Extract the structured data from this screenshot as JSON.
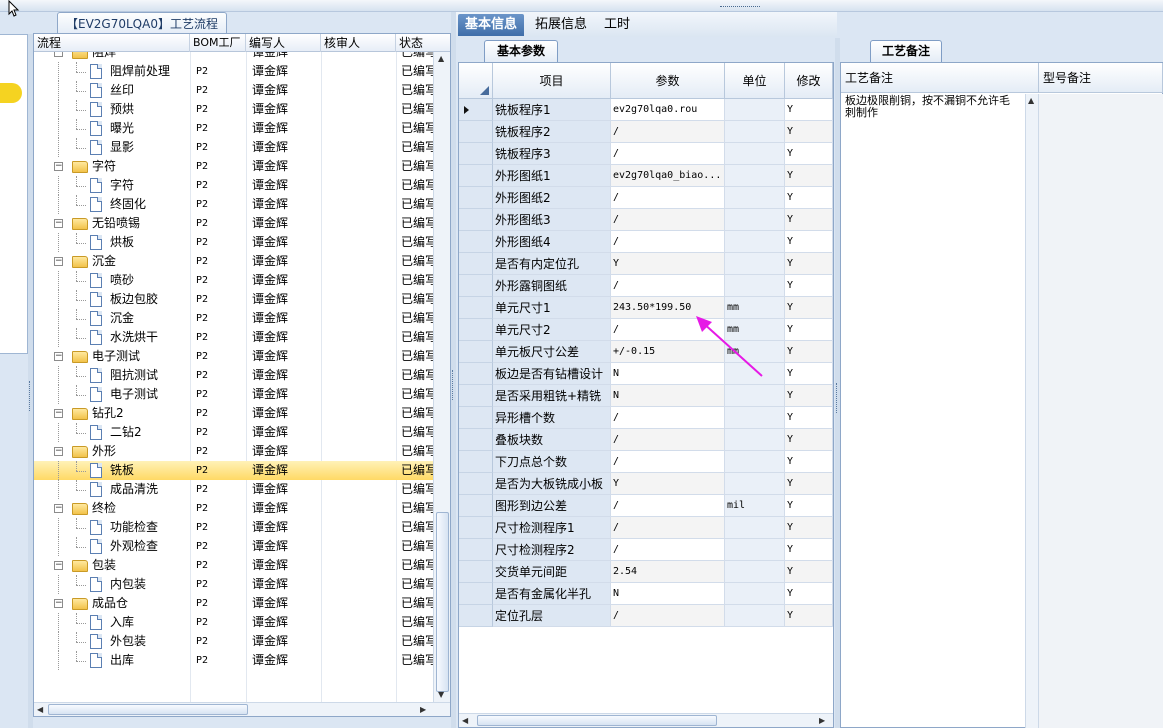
{
  "tree": {
    "tab_title": "【EV2G70LQA0】工艺流程",
    "columns": [
      "流程",
      "BOM工厂",
      "编写人",
      "核审人",
      "状态"
    ],
    "rows": [
      {
        "level": 0,
        "type": "folder",
        "name": "阻焊",
        "bom": "",
        "author": "谭金辉",
        "reviewer": "",
        "status": "已编写"
      },
      {
        "level": 1,
        "type": "doc",
        "name": "阻焊前处理",
        "bom": "P2",
        "author": "谭金辉",
        "reviewer": "",
        "status": "已编写"
      },
      {
        "level": 1,
        "type": "doc",
        "name": "丝印",
        "bom": "P2",
        "author": "谭金辉",
        "reviewer": "",
        "status": "已编写"
      },
      {
        "level": 1,
        "type": "doc",
        "name": "预烘",
        "bom": "P2",
        "author": "谭金辉",
        "reviewer": "",
        "status": "已编写"
      },
      {
        "level": 1,
        "type": "doc",
        "name": "曝光",
        "bom": "P2",
        "author": "谭金辉",
        "reviewer": "",
        "status": "已编写"
      },
      {
        "level": 1,
        "type": "doc",
        "name": "显影",
        "bom": "P2",
        "author": "谭金辉",
        "reviewer": "",
        "status": "已编写"
      },
      {
        "level": 0,
        "type": "folder",
        "name": "字符",
        "bom": "P2",
        "author": "谭金辉",
        "reviewer": "",
        "status": "已编写"
      },
      {
        "level": 1,
        "type": "doc",
        "name": "字符",
        "bom": "P2",
        "author": "谭金辉",
        "reviewer": "",
        "status": "已编写"
      },
      {
        "level": 1,
        "type": "doc",
        "name": "终固化",
        "bom": "P2",
        "author": "谭金辉",
        "reviewer": "",
        "status": "已编写"
      },
      {
        "level": 0,
        "type": "folder",
        "name": "无铅喷锡",
        "bom": "P2",
        "author": "谭金辉",
        "reviewer": "",
        "status": "已编写"
      },
      {
        "level": 1,
        "type": "doc",
        "name": "烘板",
        "bom": "P2",
        "author": "谭金辉",
        "reviewer": "",
        "status": "已编写"
      },
      {
        "level": 0,
        "type": "folder",
        "name": "沉金",
        "bom": "P2",
        "author": "谭金辉",
        "reviewer": "",
        "status": "已编写"
      },
      {
        "level": 1,
        "type": "doc",
        "name": "喷砂",
        "bom": "P2",
        "author": "谭金辉",
        "reviewer": "",
        "status": "已编写"
      },
      {
        "level": 1,
        "type": "doc",
        "name": "板边包胶",
        "bom": "P2",
        "author": "谭金辉",
        "reviewer": "",
        "status": "已编写"
      },
      {
        "level": 1,
        "type": "doc",
        "name": "沉金",
        "bom": "P2",
        "author": "谭金辉",
        "reviewer": "",
        "status": "已编写"
      },
      {
        "level": 1,
        "type": "doc",
        "name": "水洗烘干",
        "bom": "P2",
        "author": "谭金辉",
        "reviewer": "",
        "status": "已编写"
      },
      {
        "level": 0,
        "type": "folder",
        "name": "电子测试",
        "bom": "P2",
        "author": "谭金辉",
        "reviewer": "",
        "status": "已编写"
      },
      {
        "level": 1,
        "type": "doc",
        "name": "阻抗测试",
        "bom": "P2",
        "author": "谭金辉",
        "reviewer": "",
        "status": "已编写"
      },
      {
        "level": 1,
        "type": "doc",
        "name": "电子测试",
        "bom": "P2",
        "author": "谭金辉",
        "reviewer": "",
        "status": "已编写"
      },
      {
        "level": 0,
        "type": "folder",
        "name": "钻孔2",
        "bom": "P2",
        "author": "谭金辉",
        "reviewer": "",
        "status": "已编写"
      },
      {
        "level": 1,
        "type": "doc",
        "name": "二钻2",
        "bom": "P2",
        "author": "谭金辉",
        "reviewer": "",
        "status": "已编写"
      },
      {
        "level": 0,
        "type": "folder",
        "name": "外形",
        "bom": "P2",
        "author": "谭金辉",
        "reviewer": "",
        "status": "已编写"
      },
      {
        "level": 1,
        "type": "doc",
        "name": "铣板",
        "bom": "P2",
        "author": "谭金辉",
        "reviewer": "",
        "status": "已编写",
        "selected": true
      },
      {
        "level": 1,
        "type": "doc",
        "name": "成品清洗",
        "bom": "P2",
        "author": "谭金辉",
        "reviewer": "",
        "status": "已编写"
      },
      {
        "level": 0,
        "type": "folder",
        "name": "终检",
        "bom": "P2",
        "author": "谭金辉",
        "reviewer": "",
        "status": "已编写"
      },
      {
        "level": 1,
        "type": "doc",
        "name": "功能检查",
        "bom": "P2",
        "author": "谭金辉",
        "reviewer": "",
        "status": "已编写"
      },
      {
        "level": 1,
        "type": "doc",
        "name": "外观检查",
        "bom": "P2",
        "author": "谭金辉",
        "reviewer": "",
        "status": "已编写"
      },
      {
        "level": 0,
        "type": "folder",
        "name": "包装",
        "bom": "P2",
        "author": "谭金辉",
        "reviewer": "",
        "status": "已编写"
      },
      {
        "level": 1,
        "type": "doc",
        "name": "内包装",
        "bom": "P2",
        "author": "谭金辉",
        "reviewer": "",
        "status": "已编写"
      },
      {
        "level": 0,
        "type": "folder",
        "name": "成品仓",
        "bom": "P2",
        "author": "谭金辉",
        "reviewer": "",
        "status": "已编写"
      },
      {
        "level": 1,
        "type": "doc",
        "name": "入库",
        "bom": "P2",
        "author": "谭金辉",
        "reviewer": "",
        "status": "已编写"
      },
      {
        "level": 1,
        "type": "doc",
        "name": "外包装",
        "bom": "P2",
        "author": "谭金辉",
        "reviewer": "",
        "status": "已编写"
      },
      {
        "level": 1,
        "type": "doc",
        "name": "出库",
        "bom": "P2",
        "author": "谭金辉",
        "reviewer": "",
        "status": "已编写"
      }
    ]
  },
  "middle": {
    "tabs": [
      "基本信息",
      "拓展信息",
      "工时"
    ],
    "active_tab": 0,
    "sub_tab": "基本参数",
    "columns": [
      "项目",
      "参数",
      "单位",
      "修改"
    ],
    "rows": [
      {
        "item": "铣板程序1",
        "param": "ev2g70lqa0.rou",
        "unit": "",
        "mod": "Y",
        "current": true
      },
      {
        "item": "铣板程序2",
        "param": "/",
        "unit": "",
        "mod": "Y"
      },
      {
        "item": "铣板程序3",
        "param": "/",
        "unit": "",
        "mod": "Y"
      },
      {
        "item": "外形图纸1",
        "param": "ev2g70lqa0_biao...",
        "unit": "",
        "mod": "Y"
      },
      {
        "item": "外形图纸2",
        "param": "/",
        "unit": "",
        "mod": "Y"
      },
      {
        "item": "外形图纸3",
        "param": "/",
        "unit": "",
        "mod": "Y"
      },
      {
        "item": "外形图纸4",
        "param": "/",
        "unit": "",
        "mod": "Y"
      },
      {
        "item": "是否有内定位孔",
        "param": "Y",
        "unit": "",
        "mod": "Y"
      },
      {
        "item": "外形露铜图纸",
        "param": "/",
        "unit": "",
        "mod": "Y"
      },
      {
        "item": "单元尺寸1",
        "param": "243.50*199.50",
        "unit": "mm",
        "mod": "Y"
      },
      {
        "item": "单元尺寸2",
        "param": "/",
        "unit": "mm",
        "mod": "Y"
      },
      {
        "item": "单元板尺寸公差",
        "param": "+/-0.15",
        "unit": "mm",
        "mod": "Y"
      },
      {
        "item": "板边是否有钻槽设计",
        "param": "N",
        "unit": "",
        "mod": "Y"
      },
      {
        "item": "是否采用粗铣+精铣",
        "param": "N",
        "unit": "",
        "mod": "Y"
      },
      {
        "item": "异形槽个数",
        "param": "/",
        "unit": "",
        "mod": "Y"
      },
      {
        "item": "叠板块数",
        "param": "/",
        "unit": "",
        "mod": "Y"
      },
      {
        "item": "下刀点总个数",
        "param": "/",
        "unit": "",
        "mod": "Y"
      },
      {
        "item": "是否为大板铣成小板",
        "param": "Y",
        "unit": "",
        "mod": "Y"
      },
      {
        "item": "图形到边公差",
        "param": "/",
        "unit": "mil",
        "mod": "Y"
      },
      {
        "item": "尺寸检测程序1",
        "param": "/",
        "unit": "",
        "mod": "Y"
      },
      {
        "item": "尺寸检测程序2",
        "param": "/",
        "unit": "",
        "mod": "Y"
      },
      {
        "item": "交货单元间距",
        "param": "2.54",
        "unit": "",
        "mod": "Y"
      },
      {
        "item": "是否有金属化半孔",
        "param": "N",
        "unit": "",
        "mod": "Y"
      },
      {
        "item": "定位孔层",
        "param": "/",
        "unit": "",
        "mod": "Y"
      }
    ]
  },
  "right": {
    "tab": "工艺备注",
    "columns": [
      "工艺备注",
      "型号备注"
    ],
    "note": "板边极限削铜，按不漏铜不允许毛刺制作"
  },
  "colors": {
    "annotation_arrow": "#e619e6",
    "selected_row": "#ffd965",
    "active_tab": "#3f6ea9"
  }
}
